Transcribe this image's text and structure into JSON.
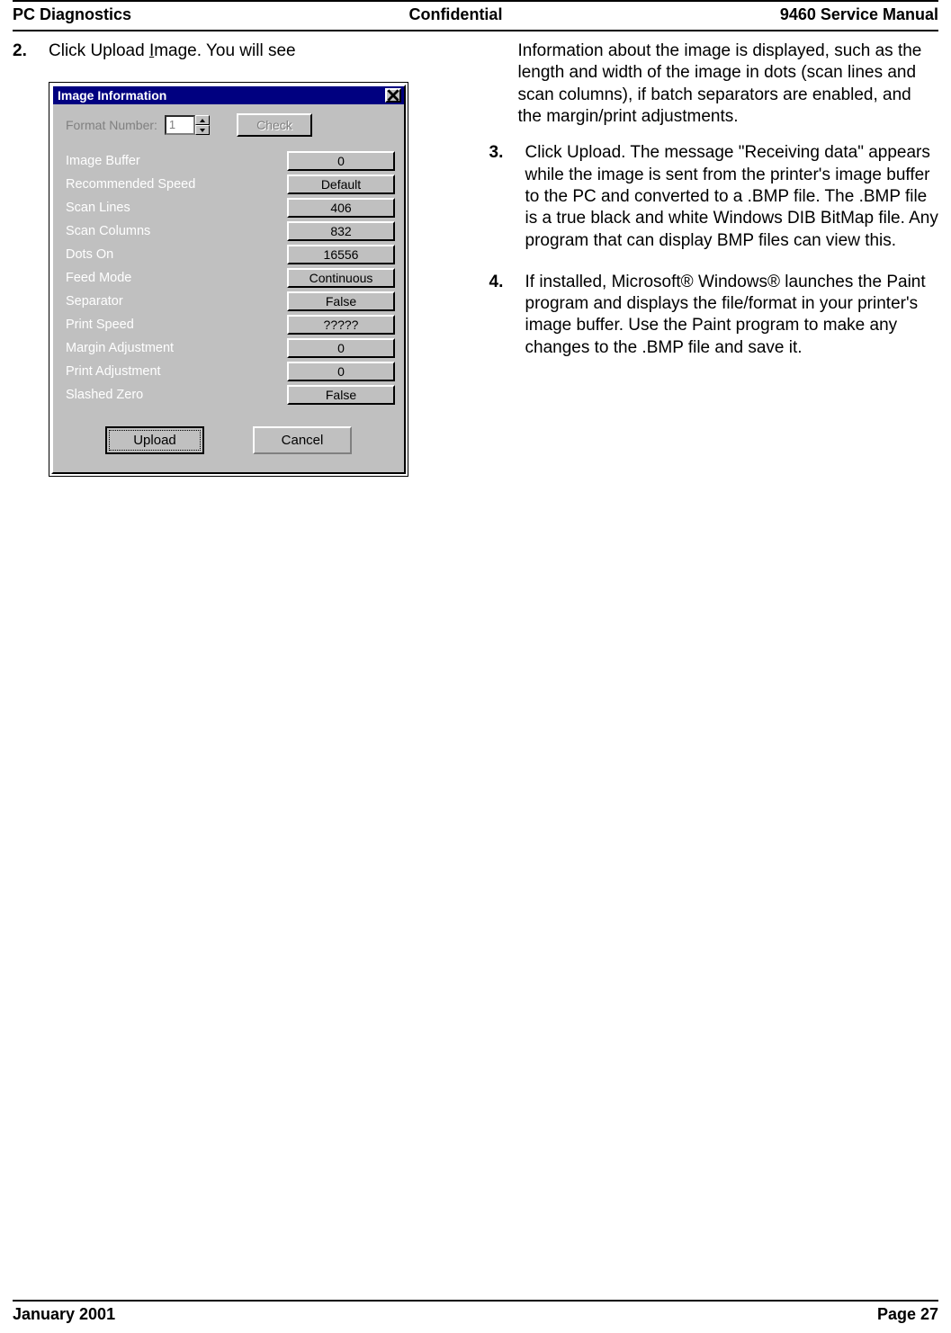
{
  "header": {
    "left": "PC Diagnostics",
    "center": "Confidential",
    "right": "9460 Service Manual"
  },
  "footer": {
    "left": "January 2001",
    "right": "Page 27"
  },
  "left_col": {
    "step2_num": "2.",
    "step2_a": "Click Upload ",
    "step2_under": "I",
    "step2_b": "mage.  You will see"
  },
  "dialog": {
    "title": "Image Information",
    "format_label": "Format Number:",
    "format_value": "1",
    "check_label": "Check",
    "rows": [
      {
        "label": "Image Buffer",
        "value": "0"
      },
      {
        "label": "Recommended Speed",
        "value": "Default"
      },
      {
        "label": "Scan Lines",
        "value": "406"
      },
      {
        "label": "Scan Columns",
        "value": "832"
      },
      {
        "label": "Dots On",
        "value": "16556"
      },
      {
        "label": "Feed Mode",
        "value": "Continuous"
      },
      {
        "label": "Separator",
        "value": "False"
      },
      {
        "label": "Print Speed",
        "value": "?????"
      },
      {
        "label": "Margin Adjustment",
        "value": "0"
      },
      {
        "label": "Print Adjustment",
        "value": "0"
      },
      {
        "label": "Slashed Zero",
        "value": "False"
      }
    ],
    "upload_label": "Upload",
    "cancel_label": "Cancel"
  },
  "right_col": {
    "intro": "Information about the image is displayed, such as the length and width of the image in dots (scan lines and scan columns), if batch separators are enabled, and the margin/print adjustments.",
    "step3_num": "3.",
    "step3_text": "Click Upload.  The message \"Receiving data\" appears while the image is sent from the printer's image buffer to the PC and converted to a .BMP file. The .BMP file is a true black and white Windows DIB BitMap file.  Any program that can display BMP files can view this.",
    "step4_num": "4.",
    "step4_a": "If installed, Microsoft",
    "step4_b": " Windows",
    "step4_c": " launches the Paint program and displays the file/format in your printer's image buffer.  Use the Paint program to make any changes to the .BMP file and save it.",
    "reg": "®"
  }
}
